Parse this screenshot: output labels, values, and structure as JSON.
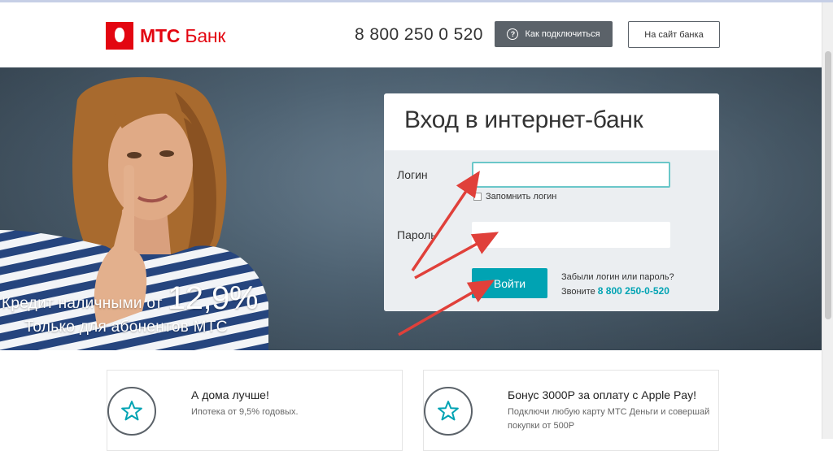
{
  "header": {
    "logo_bold": "МТС",
    "logo_text": "Банк",
    "phone": "8 800 250 0 520",
    "how_to_connect": "Как подключиться",
    "bank_site": "На сайт банка"
  },
  "hero": {
    "promo_line1": "Кредит наличными от",
    "promo_percent": "12,9%",
    "promo_line2": "Только для абонентов МТС"
  },
  "login": {
    "title": "Вход в интернет-банк",
    "login_label": "Логин",
    "login_value": "",
    "remember_label": "Запомнить логин",
    "password_label": "Пароль",
    "password_value": "",
    "submit": "Войти",
    "forgot": "Забыли логин или пароль?",
    "call_prefix": "Звоните",
    "call_phone": "8 800 250-0-520"
  },
  "promos": [
    {
      "title": "А дома лучше!",
      "text": "Ипотека от 9,5% годовых.",
      "icon": "star-icon"
    },
    {
      "title": "Бонус 3000Р за оплату с Apple Pay!",
      "text": "Подключи любую карту МТС Деньги и совершай покупки от 500Р",
      "icon": "star-icon"
    }
  ],
  "colors": {
    "brand_red": "#e30611",
    "accent_teal": "#00a3b3",
    "annotation_arrow": "#e0403a"
  }
}
